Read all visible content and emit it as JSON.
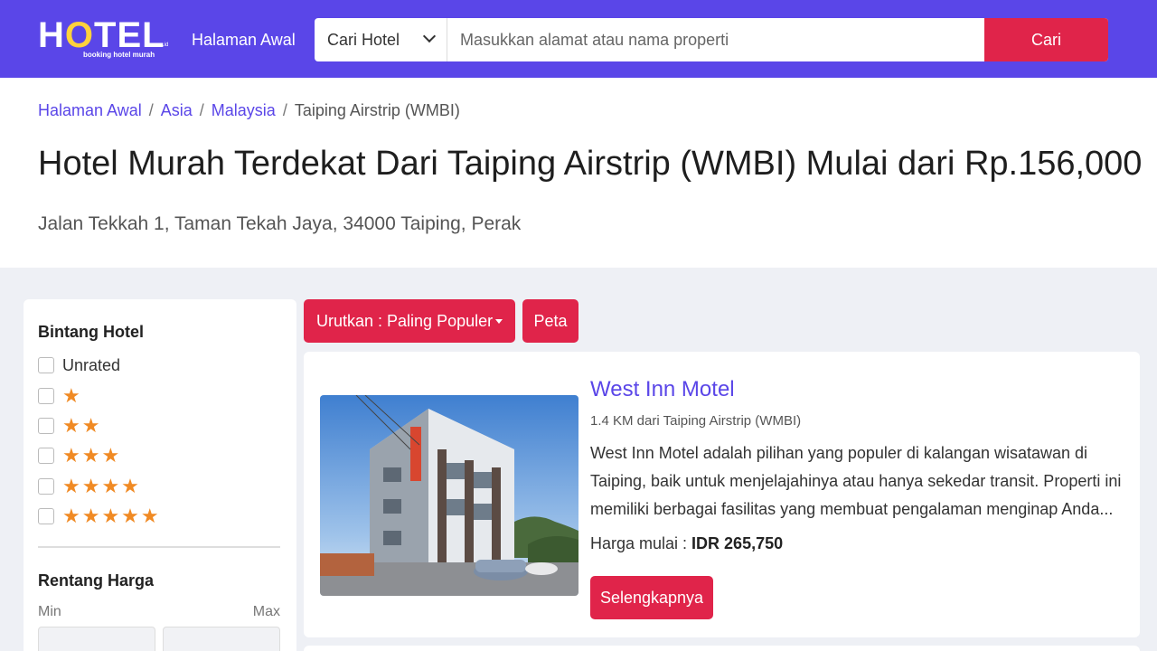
{
  "header": {
    "logo_text": "HOTEL",
    "logo_subtitle": "booking hotel murah",
    "logo_tag": ".co.id",
    "nav_home": "Halaman Awal",
    "search_type": "Cari Hotel",
    "search_placeholder": "Masukkan alamat atau nama properti",
    "search_button": "Cari"
  },
  "breadcrumb": {
    "items": [
      "Halaman Awal",
      "Asia",
      "Malaysia"
    ],
    "current": "Taiping Airstrip (WMBI)"
  },
  "page": {
    "title": "Hotel Murah Terdekat Dari Taiping Airstrip (WMBI) Mulai dari Rp.156,000",
    "address": "Jalan Tekkah 1, Taman Tekah Jaya, 34000 Taiping, Perak"
  },
  "sidebar": {
    "star_heading": "Bintang Hotel",
    "unrated_label": "Unrated",
    "star_options": [
      "★",
      "★★",
      "★★★",
      "★★★★",
      "★★★★★"
    ],
    "price_heading": "Rentang Harga",
    "min_label": "Min",
    "max_label": "Max"
  },
  "toolbar": {
    "sort_label": "Urutkan : Paling Populer",
    "map_label": "Peta"
  },
  "hotels": [
    {
      "name": "West Inn Motel",
      "distance": "1.4 KM dari Taiping Airstrip (WMBI)",
      "description": "West Inn Motel adalah pilihan yang populer di kalangan wisatawan di Taiping, baik untuk menjelajahinya atau hanya sekedar transit. Properti ini memiliki berbagai fasilitas yang membuat pengalaman menginap Anda...",
      "price_label": "Harga mulai : ",
      "price": "IDR 265,750",
      "more_button": "Selengkapnya"
    }
  ],
  "colors": {
    "brand": "#5a46e8",
    "accent": "#e0244a",
    "star": "#f08a24"
  }
}
